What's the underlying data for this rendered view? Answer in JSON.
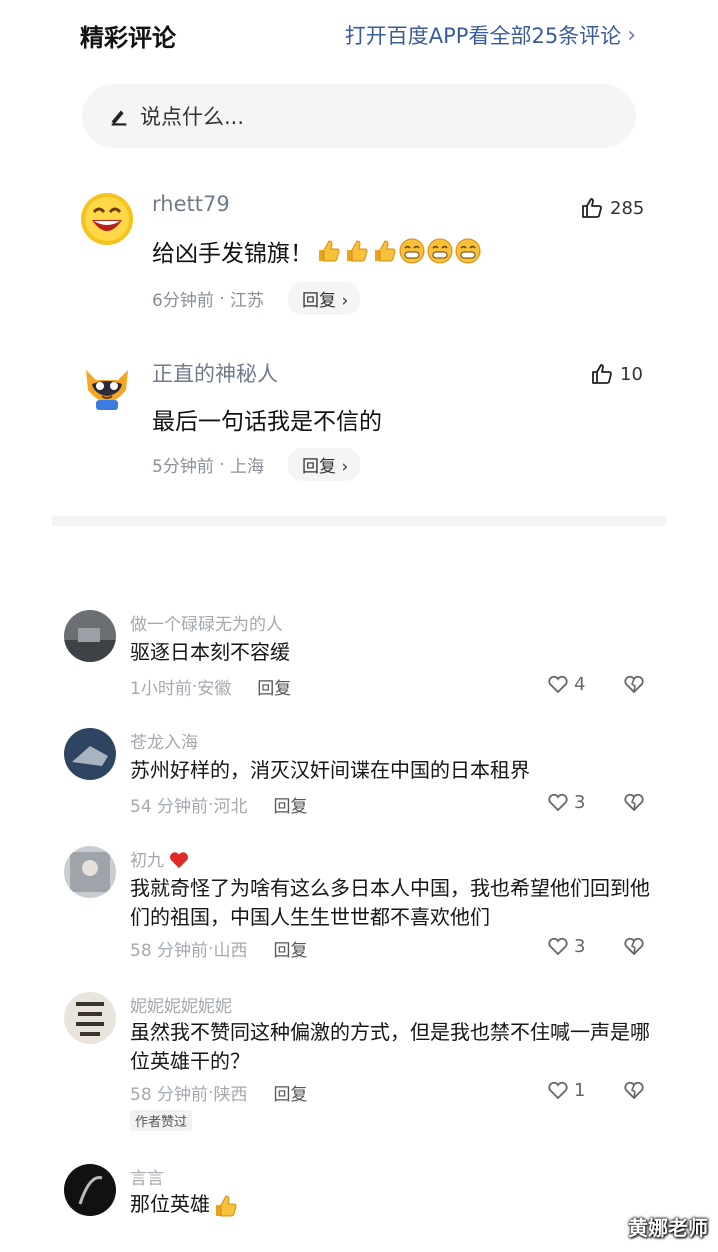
{
  "header": {
    "title": "精彩评论",
    "open_app": "打开百度APP看全部25条评论"
  },
  "input": {
    "placeholder": "说点什么..."
  },
  "baidu_comments": [
    {
      "user": "rhett79",
      "text": "给凶手发锦旗！",
      "emojis": [
        "thumbs-up-emoji",
        "thumbs-up-emoji",
        "thumbs-up-emoji",
        "grin-emoji",
        "grin-emoji",
        "grin-emoji"
      ],
      "time": "6分钟前",
      "location": "江苏",
      "reply": "回复",
      "likes": "285"
    },
    {
      "user": "正直的神秘人",
      "text": "最后一句话我是不信的",
      "time": "5分钟前",
      "location": "上海",
      "reply": "回复",
      "likes": "10"
    }
  ],
  "douyin_comments": [
    {
      "user": "做一个碌碌无为的人",
      "text": "驱逐日本刻不容缓",
      "time": "1小时前",
      "location": "安徽",
      "reply": "回复",
      "likes": "4"
    },
    {
      "user": "苍龙入海",
      "text": "苏州好样的，消灭汉奸间谍在中国的日本租界",
      "time": "54 分钟前",
      "location": "河北",
      "reply": "回复",
      "likes": "3"
    },
    {
      "user": "初九",
      "text": "我就奇怪了为啥有这么多日本人中国，我也希望他们回到他们的祖国，中国人生生世世都不喜欢他们",
      "time": "58 分钟前",
      "location": "山西",
      "reply": "回复",
      "likes": "3"
    },
    {
      "user": "妮妮妮妮妮妮",
      "text": "虽然我不赞同这种偏激的方式，但是我也禁不住喊一声是哪位英雄干的？",
      "time": "58 分钟前",
      "location": "陕西",
      "reply": "回复",
      "likes": "1",
      "badge": "作者赞过"
    },
    {
      "user": "言言",
      "text": "那位英雄"
    }
  ],
  "watermark": "黄娜老师",
  "colors": {
    "link_blue": "#3a5c9a",
    "name_gray": "#707b8b",
    "meta_gray": "#a4a8af"
  }
}
